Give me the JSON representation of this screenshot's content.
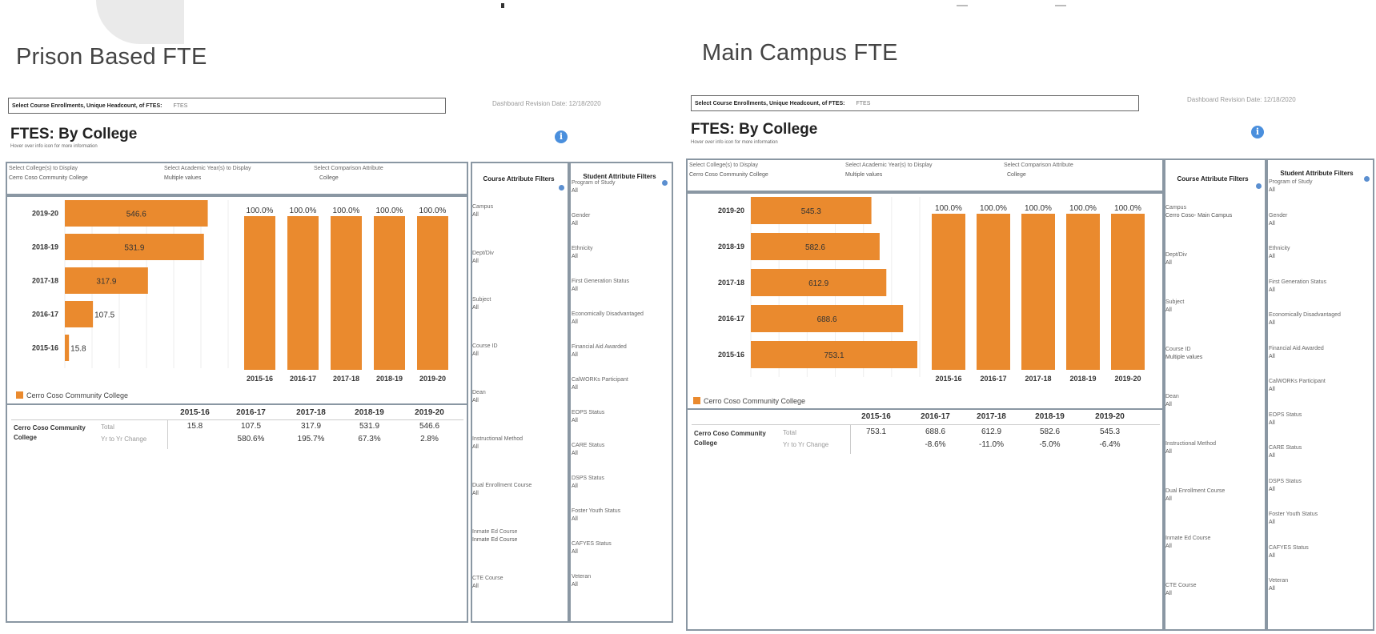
{
  "colors": {
    "bar": "#ea8a2e",
    "info": "#4a8fdd",
    "border": "#8a97a3"
  },
  "panels": [
    {
      "heading": "Prison Based FTE",
      "selector_label": "Select Course Enrollments, Unique Headcount, of FTES:",
      "selector_value": "FTES",
      "revision_date": "Dashboard Revision Date: 12/18/2020",
      "title": "FTES: By College",
      "hover_note": "Hover over info icon for more information",
      "select_college_label": "Select College(s) to Display",
      "select_college_value": "Cerro Coso Community College",
      "select_year_label": "Select Academic Year(s) to Display",
      "select_year_value": "Multiple values",
      "select_attr_label": "Select Comparison Attribute",
      "select_attr_value": "College",
      "legend": "Cerro Coso Community College",
      "table": {
        "headers": [
          "2015-16",
          "2016-17",
          "2017-18",
          "2018-19",
          "2019-20"
        ],
        "row_label": "Cerro Coso Community College",
        "total_label": "Total",
        "change_label": "Yr to Yr Change",
        "totals": [
          "15.8",
          "107.5",
          "317.9",
          "531.9",
          "546.6"
        ],
        "changes": [
          "",
          "580.6%",
          "195.7%",
          "67.3%",
          "2.8%"
        ]
      },
      "course_filters_title": "Course Attribute Filters",
      "course_filters": [
        {
          "label": "Campus",
          "value": "All"
        },
        {
          "label": "Dept/Div",
          "value": "All"
        },
        {
          "label": "Subject",
          "value": "All"
        },
        {
          "label": "Course ID",
          "value": "All"
        },
        {
          "label": "Dean",
          "value": "All"
        },
        {
          "label": "Instructional Method",
          "value": "All"
        },
        {
          "label": "Dual Enrollment Course",
          "value": "All"
        },
        {
          "label": "Inmate Ed Course",
          "value": "Inmate Ed Course"
        },
        {
          "label": "CTE Course",
          "value": "All"
        }
      ],
      "student_filters_title": "Student Attribute Filters",
      "student_filters": [
        {
          "label": "Program of Study",
          "value": "All"
        },
        {
          "label": "Gender",
          "value": "All"
        },
        {
          "label": "Ethnicity",
          "value": "All"
        },
        {
          "label": "First Generation Status",
          "value": "All"
        },
        {
          "label": "Economically Disadvantaged",
          "value": "All"
        },
        {
          "label": "Financial Aid Awarded",
          "value": "All"
        },
        {
          "label": "CalWORKs Participant",
          "value": "All"
        },
        {
          "label": "EOPS Status",
          "value": "All"
        },
        {
          "label": "CARE Status",
          "value": "All"
        },
        {
          "label": "DSPS Status",
          "value": "All"
        },
        {
          "label": "Foster Youth Status",
          "value": "All"
        },
        {
          "label": "CAFYES Status",
          "value": "All"
        },
        {
          "label": "Veteran",
          "value": "All"
        }
      ]
    },
    {
      "heading": "Main Campus FTE",
      "selector_label": "Select Course Enrollments, Unique Headcount, of FTES:",
      "selector_value": "FTES",
      "revision_date": "Dashboard Revision Date: 12/18/2020",
      "title": "FTES: By College",
      "hover_note": "Hover over info icon for more information",
      "select_college_label": "Select College(s) to Display",
      "select_college_value": "Cerro Coso Community College",
      "select_year_label": "Select Academic Year(s) to Display",
      "select_year_value": "Multiple values",
      "select_attr_label": "Select Comparison Attribute",
      "select_attr_value": "College",
      "legend": "Cerro Coso Community College",
      "table": {
        "headers": [
          "2015-16",
          "2016-17",
          "2017-18",
          "2018-19",
          "2019-20"
        ],
        "row_label": "Cerro Coso Community College",
        "total_label": "Total",
        "change_label": "Yr to Yr Change",
        "totals": [
          "753.1",
          "688.6",
          "612.9",
          "582.6",
          "545.3"
        ],
        "changes": [
          "",
          "-8.6%",
          "-11.0%",
          "-5.0%",
          "-6.4%"
        ]
      },
      "course_filters_title": "Course Attribute Filters",
      "course_filters": [
        {
          "label": "Campus",
          "value": "Cerro Coso- Main Campus"
        },
        {
          "label": "Dept/Div",
          "value": "All"
        },
        {
          "label": "Subject",
          "value": "All"
        },
        {
          "label": "Course ID",
          "value": "Multiple values"
        },
        {
          "label": "Dean",
          "value": "All"
        },
        {
          "label": "Instructional Method",
          "value": "All"
        },
        {
          "label": "Dual Enrollment Course",
          "value": "All"
        },
        {
          "label": "Inmate Ed Course",
          "value": "All"
        },
        {
          "label": "CTE Course",
          "value": "All"
        }
      ],
      "student_filters_title": "Student Attribute Filters",
      "student_filters": [
        {
          "label": "Program of Study",
          "value": "All"
        },
        {
          "label": "Gender",
          "value": "All"
        },
        {
          "label": "Ethnicity",
          "value": "All"
        },
        {
          "label": "First Generation Status",
          "value": "All"
        },
        {
          "label": "Economically Disadvantaged",
          "value": "All"
        },
        {
          "label": "Financial Aid Awarded",
          "value": "All"
        },
        {
          "label": "CalWORKs Participant",
          "value": "All"
        },
        {
          "label": "EOPS Status",
          "value": "All"
        },
        {
          "label": "CARE Status",
          "value": "All"
        },
        {
          "label": "DSPS Status",
          "value": "All"
        },
        {
          "label": "Foster Youth Status",
          "value": "All"
        },
        {
          "label": "CAFYES Status",
          "value": "All"
        },
        {
          "label": "Veteran",
          "value": "All"
        }
      ]
    }
  ],
  "chart_data": [
    {
      "type": "bar",
      "orientation": "horizontal",
      "categories": [
        "2019-20",
        "2018-19",
        "2017-18",
        "2016-17",
        "2015-16"
      ],
      "values": [
        546.6,
        531.9,
        317.9,
        107.5,
        15.8
      ],
      "series": [
        {
          "name": "Cerro Coso Community College",
          "values": [
            546.6,
            531.9,
            317.9,
            107.5,
            15.8
          ]
        }
      ],
      "xlim": [
        0,
        600
      ]
    },
    {
      "type": "bar",
      "orientation": "vertical",
      "categories": [
        "2015-16",
        "2016-17",
        "2017-18",
        "2018-19",
        "2019-20"
      ],
      "values": [
        100.0,
        100.0,
        100.0,
        100.0,
        100.0
      ],
      "value_labels": [
        "100.0%",
        "100.0%",
        "100.0%",
        "100.0%",
        "100.0%"
      ],
      "ylim": [
        0,
        100
      ]
    },
    {
      "type": "bar",
      "orientation": "horizontal",
      "categories": [
        "2019-20",
        "2018-19",
        "2017-18",
        "2016-17",
        "2015-16"
      ],
      "values": [
        545.3,
        582.6,
        612.9,
        688.6,
        753.1
      ],
      "series": [
        {
          "name": "Cerro Coso Community College",
          "values": [
            545.3,
            582.6,
            612.9,
            688.6,
            753.1
          ]
        }
      ],
      "xlim": [
        0,
        753.1
      ]
    },
    {
      "type": "bar",
      "orientation": "vertical",
      "categories": [
        "2015-16",
        "2016-17",
        "2017-18",
        "2018-19",
        "2019-20"
      ],
      "values": [
        100.0,
        100.0,
        100.0,
        100.0,
        100.0
      ],
      "value_labels": [
        "100.0%",
        "100.0%",
        "100.0%",
        "100.0%",
        "100.0%"
      ],
      "ylim": [
        0,
        100
      ]
    }
  ]
}
